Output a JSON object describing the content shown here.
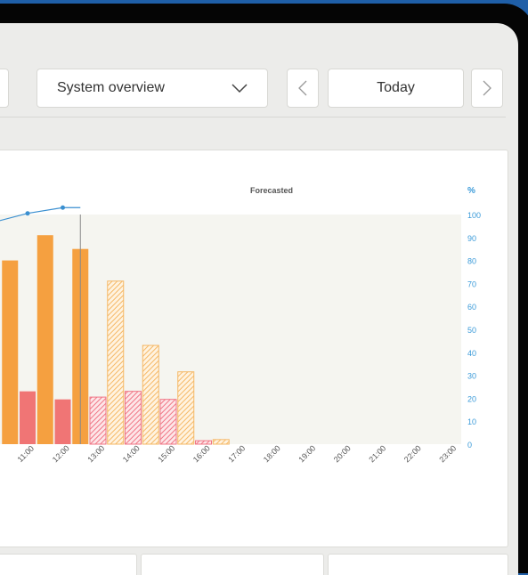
{
  "toolbar": {
    "view_select": "System overview",
    "date_label": "Today",
    "prev_icon": "chevron-left-icon",
    "next_icon": "chevron-right-icon",
    "dropdown_icon": "chevron-down-icon"
  },
  "chart_title": "Forecasted",
  "colors": {
    "actual_bar": "#f5a040",
    "actual_secondary": "#f07070",
    "forecast_bar": "#f5b866",
    "forecast_secondary": "#f07585",
    "line": "#3a8fd0",
    "y_axis_text": "#3a9ad9"
  },
  "chart_data": {
    "type": "bar",
    "y_axis_label": "%",
    "ylim": [
      0,
      100
    ],
    "y_ticks": [
      0,
      10,
      20,
      30,
      40,
      50,
      60,
      70,
      80,
      90,
      100
    ],
    "x_ticks": [
      "11:00",
      "12:00",
      "13:00",
      "14:00",
      "15:00",
      "16:00",
      "17:00",
      "18:00",
      "19:00",
      "20:00",
      "21:00",
      "22:00",
      "23:00"
    ],
    "current_time_marker": "12:30",
    "series": [
      {
        "kind": "bar",
        "style": "solid",
        "color": "#f5a040",
        "points": [
          {
            "x": "10:30",
            "y": 80
          },
          {
            "x": "11:30",
            "y": 91
          },
          {
            "x": "12:30",
            "y": 85
          }
        ]
      },
      {
        "kind": "bar",
        "style": "solid",
        "color": "#f07575",
        "points": [
          {
            "x": "11:00",
            "y": 23
          },
          {
            "x": "12:00",
            "y": 19.5
          }
        ]
      },
      {
        "kind": "bar",
        "style": "hatched",
        "color": "#f5b866",
        "points": [
          {
            "x": "13:30",
            "y": 71
          },
          {
            "x": "14:30",
            "y": 43
          },
          {
            "x": "15:30",
            "y": 31.5
          },
          {
            "x": "16:30",
            "y": 2
          }
        ]
      },
      {
        "kind": "bar",
        "style": "hatched",
        "color": "#f07585",
        "points": [
          {
            "x": "13:00",
            "y": 20.5
          },
          {
            "x": "14:00",
            "y": 23
          },
          {
            "x": "15:00",
            "y": 19.5
          },
          {
            "x": "16:00",
            "y": 1.5
          }
        ]
      },
      {
        "kind": "line",
        "color": "#3a8fd0",
        "points": [
          {
            "x": "10:00",
            "y": 96.5
          },
          {
            "x": "11:00",
            "y": 100.5
          },
          {
            "x": "12:00",
            "y": 103
          },
          {
            "x": "12:30",
            "y": 103
          }
        ]
      }
    ]
  }
}
